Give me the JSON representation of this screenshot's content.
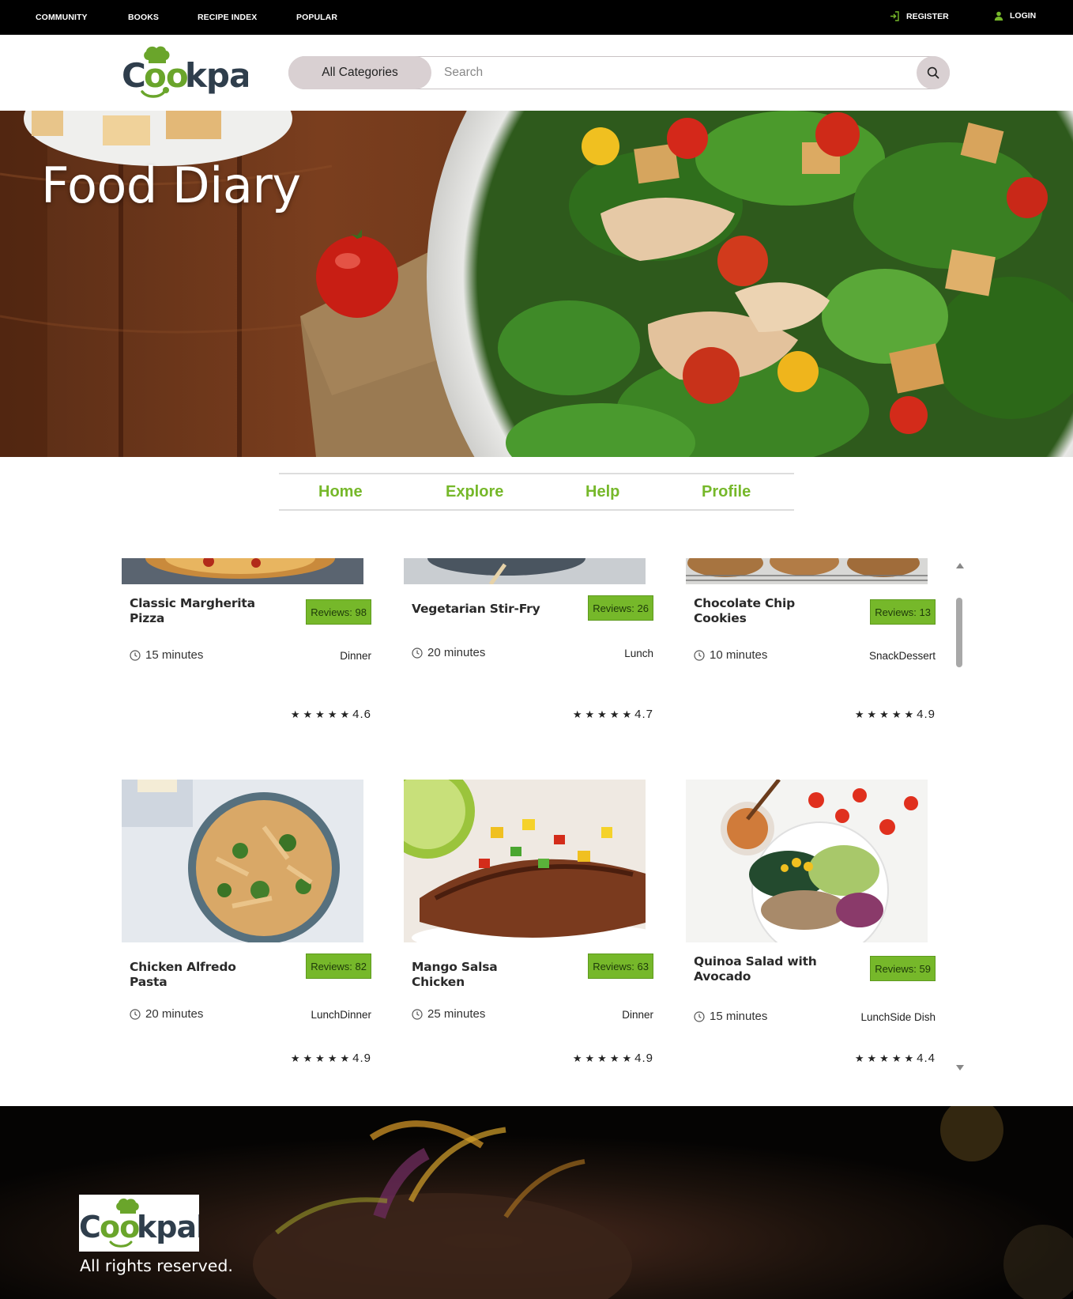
{
  "topbar": {
    "nav": [
      "COMMUNITY",
      "BOOKS",
      "RECIPE INDEX",
      "POPULAR"
    ],
    "register_label": "REGISTER",
    "login_label": "LOGIN"
  },
  "brand": {
    "name": "Cookpal",
    "color_dark": "#2f3e4c",
    "color_accent": "#6aa52b"
  },
  "search": {
    "category_label": "All Categories",
    "placeholder": "Search",
    "value": ""
  },
  "hero": {
    "title": "Food Diary"
  },
  "tabs": [
    "Home",
    "Explore",
    "Help",
    "Profile"
  ],
  "colors": {
    "accent_green": "#76b82a",
    "topbar_bg": "#000000",
    "search_pill": "#d9d0d2"
  },
  "recipes": [
    {
      "name": "Classic Margherita Pizza",
      "reviews": "Reviews: 98",
      "time": "15 minutes",
      "meal": "Dinner",
      "rating": "4.6",
      "stars": 5,
      "icons": [
        "clock-icon"
      ]
    },
    {
      "name": "Vegetarian Stir-Fry",
      "reviews": "Reviews: 26",
      "time": "20 minutes",
      "meal": "Lunch",
      "rating": "4.7",
      "stars": 5,
      "icons": [
        "clock-icon"
      ]
    },
    {
      "name": "Chocolate Chip Cookies",
      "reviews": "Reviews: 13",
      "time": "10 minutes",
      "meal": "SnackDessert",
      "rating": "4.9",
      "stars": 5,
      "icons": [
        "clock-icon"
      ]
    },
    {
      "name": "Chicken Alfredo Pasta",
      "reviews": "Reviews: 82",
      "time": "20 minutes",
      "meal": "LunchDinner",
      "rating": "4.9",
      "stars": 5,
      "icons": [
        "clock-icon"
      ]
    },
    {
      "name": "Mango Salsa Chicken",
      "reviews": "Reviews: 63",
      "time": "25 minutes",
      "meal": "Dinner",
      "rating": "4.9",
      "stars": 5,
      "icons": [
        "clock-icon"
      ]
    },
    {
      "name": "Quinoa Salad with Avocado",
      "reviews": "Reviews: 59",
      "time": "15 minutes",
      "meal": "LunchSide Dish",
      "rating": "4.4",
      "stars": 5,
      "icons": [
        "clock-icon"
      ]
    }
  ],
  "footer": {
    "rights": "All rights reserved."
  }
}
